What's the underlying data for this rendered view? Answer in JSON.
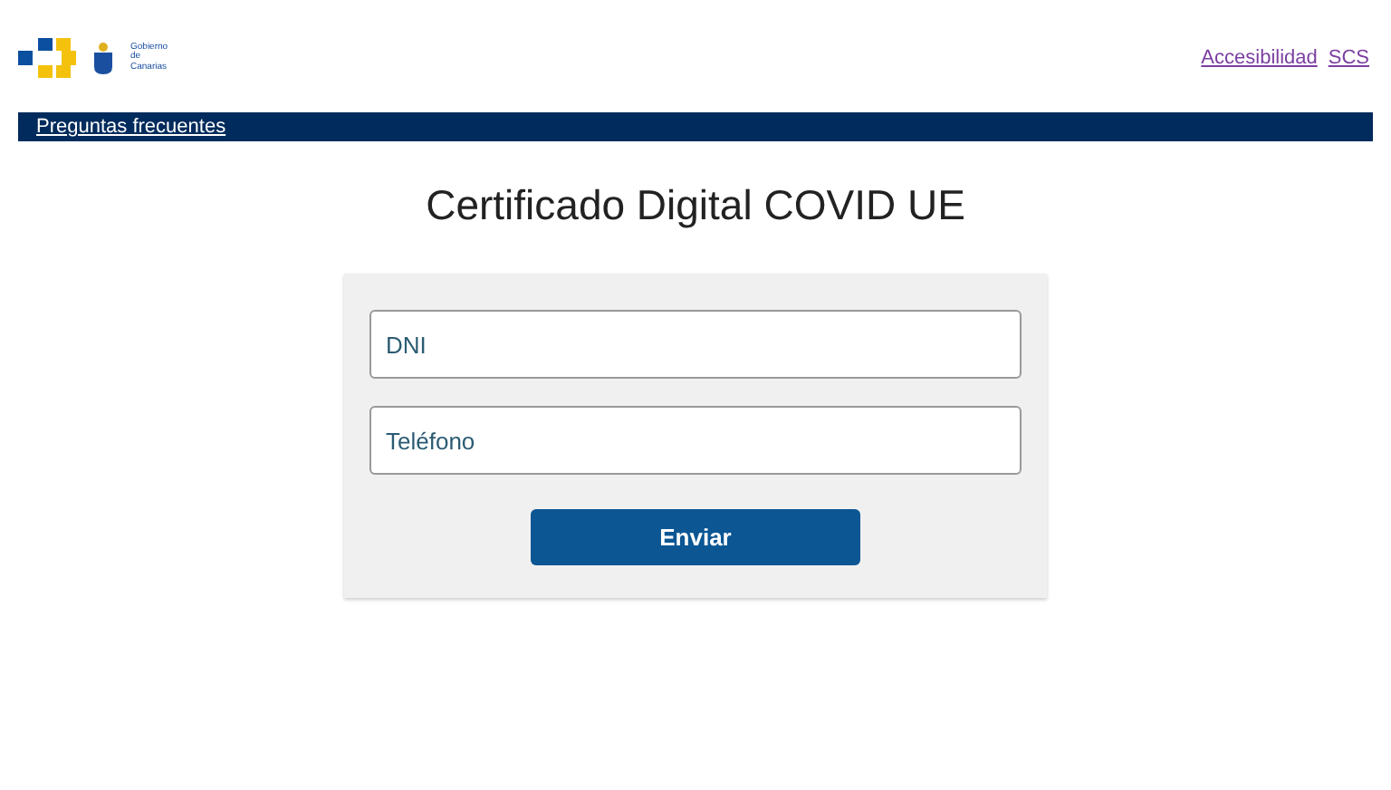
{
  "header": {
    "logo_text": "Gobierno de Canarias",
    "links": [
      "Accesibilidad",
      "SCS"
    ]
  },
  "navbar": {
    "links": [
      "Preguntas frecuentes"
    ]
  },
  "title": "Certificado Digital COVID UE",
  "form": {
    "fields": [
      {
        "placeholder": "DNI"
      },
      {
        "placeholder": "Teléfono"
      }
    ],
    "submit": "Enviar"
  }
}
